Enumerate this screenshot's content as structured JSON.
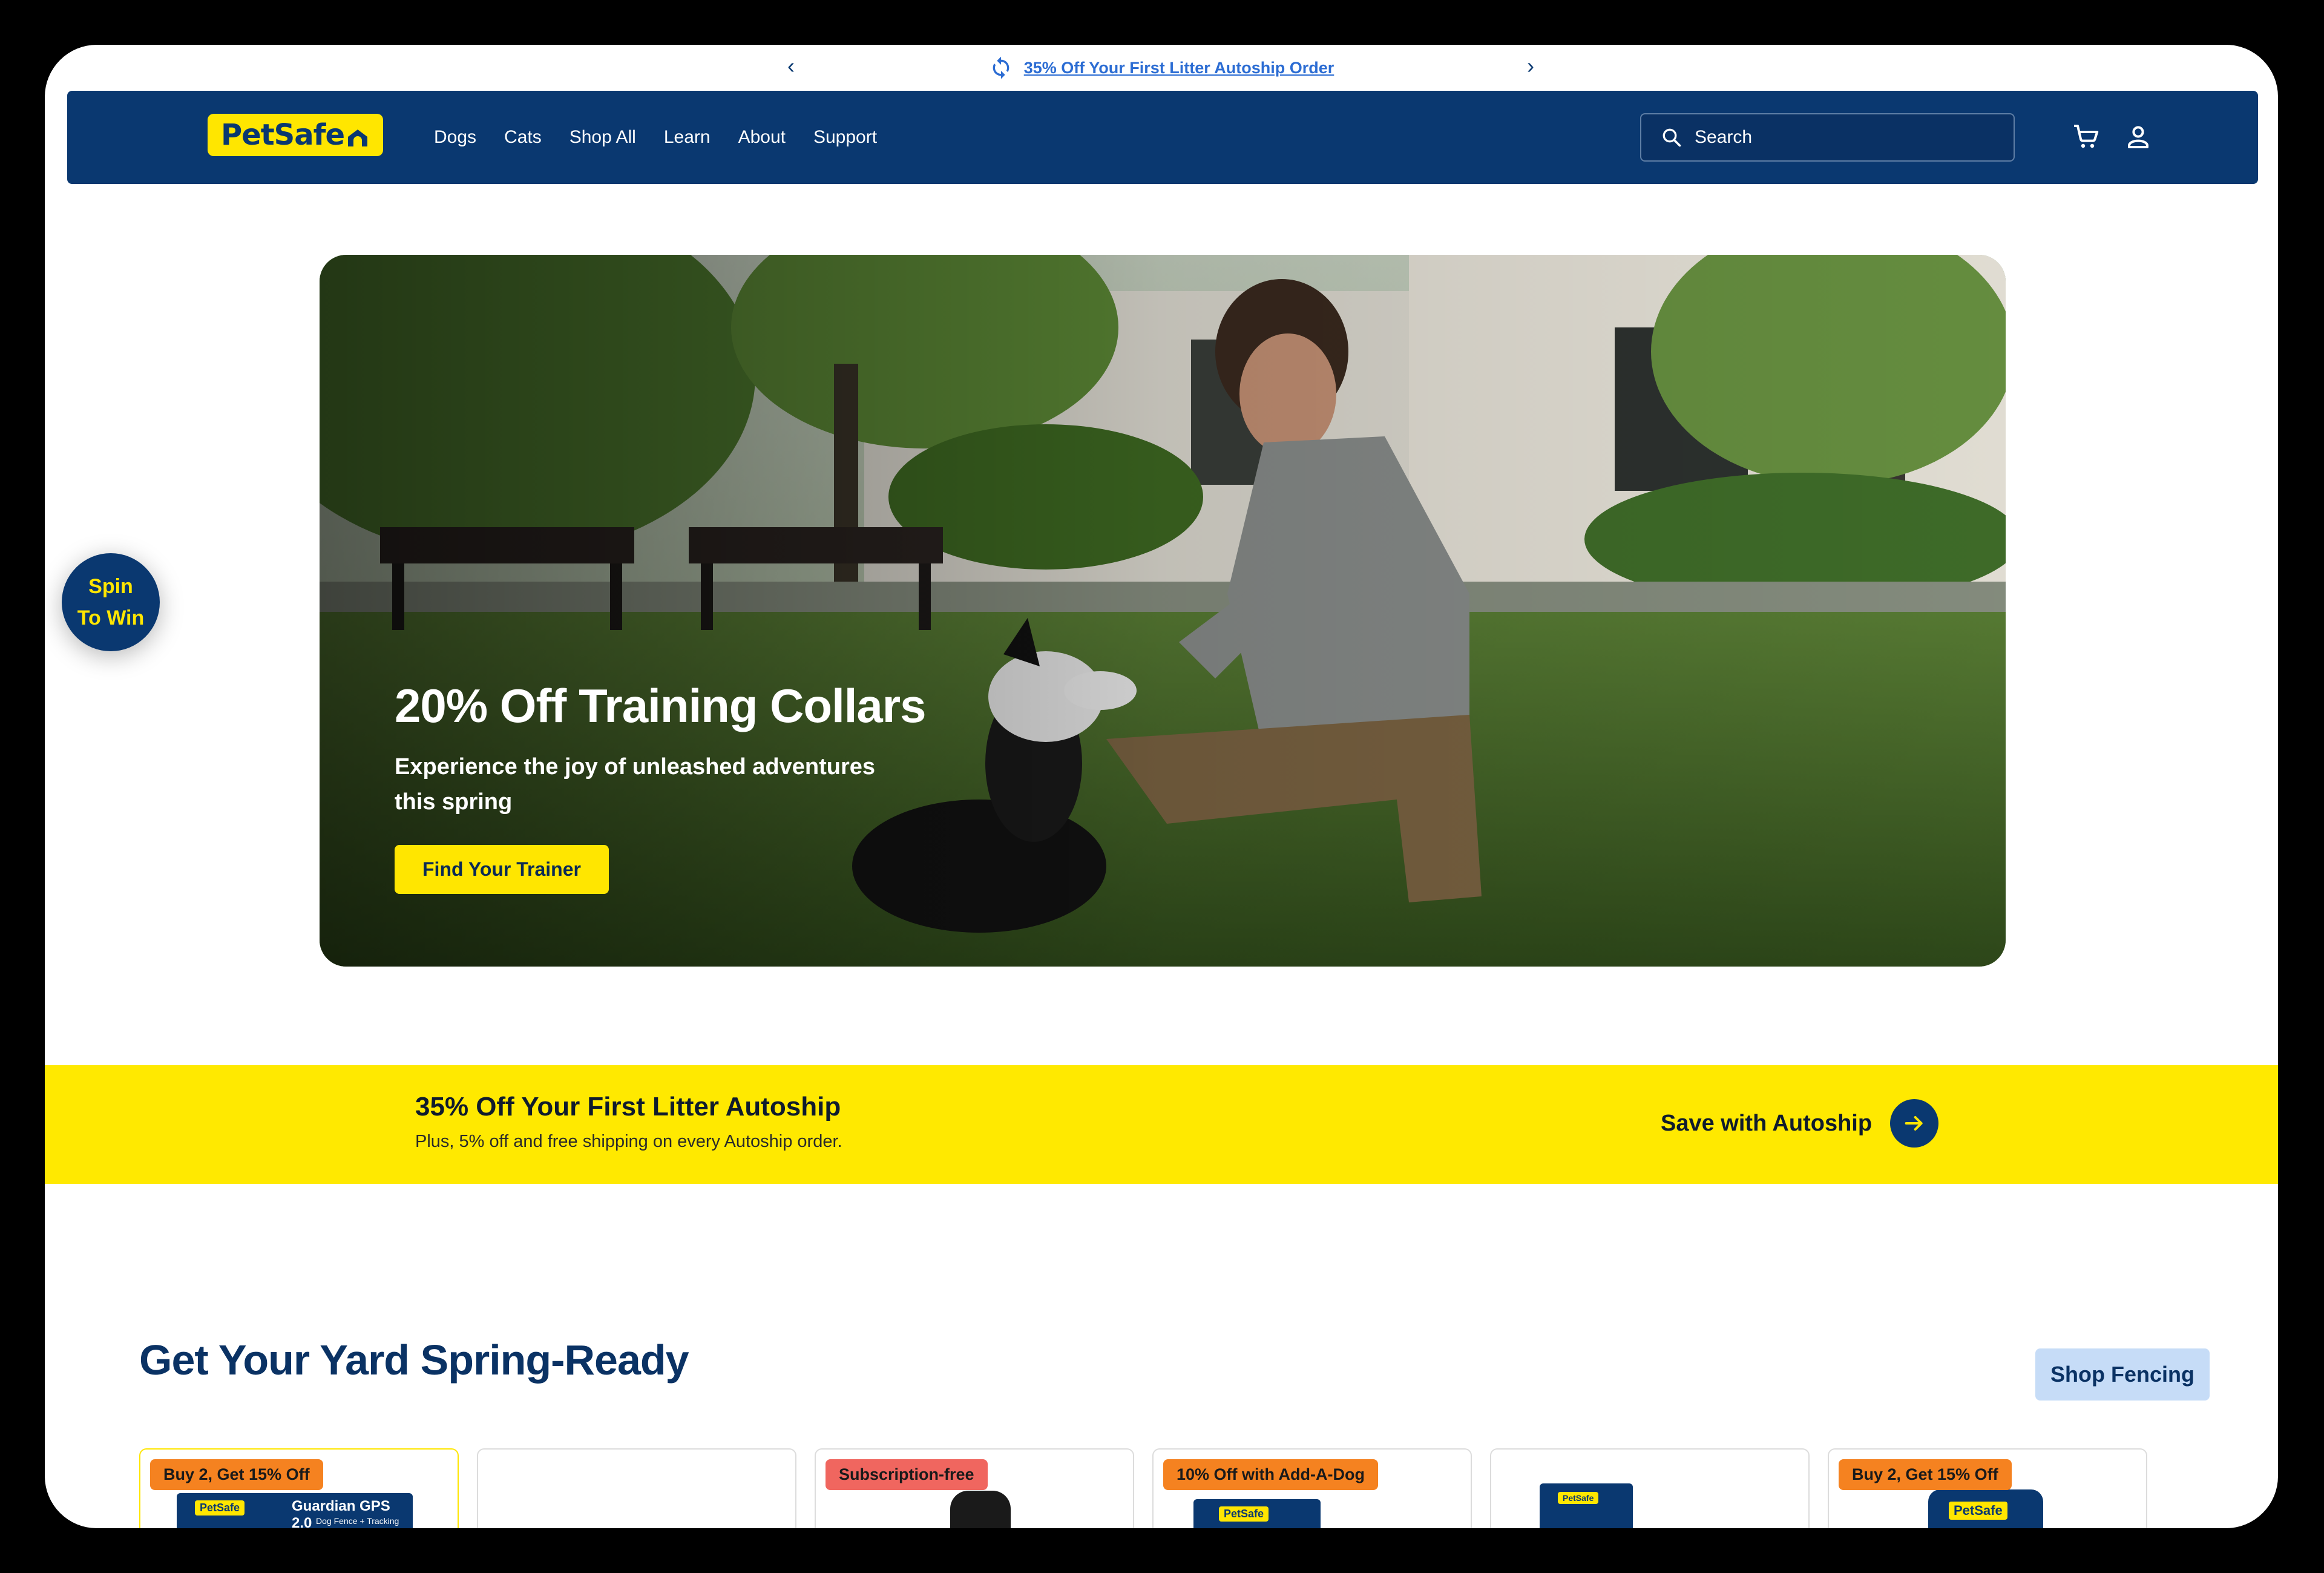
{
  "announcement": {
    "text": "35% Off Your First Litter Autoship Order",
    "prev": "‹",
    "next": "›"
  },
  "header": {
    "logo": "PetSafe",
    "nav": [
      "Dogs",
      "Cats",
      "Shop All",
      "Learn",
      "About",
      "Support"
    ],
    "search_placeholder": "Search"
  },
  "hero": {
    "title": "20% Off Training Collars",
    "subtitle": "Experience the joy of unleashed adventures this spring",
    "cta": "Find Your Trainer"
  },
  "spin": {
    "label": "Spin To Win"
  },
  "autoship": {
    "title": "35% Off Your First Litter Autoship",
    "subtitle": "Plus, 5% off and free shipping on every Autoship order.",
    "link": "Save with Autoship"
  },
  "yard": {
    "title": "Get Your Yard Spring-Ready",
    "button": "Shop Fencing",
    "products": [
      {
        "badge": "Buy 2, Get 15% Off",
        "badge_color": "#f58220",
        "product_text": "Guardian GPS 2.0",
        "product_subtext": "Dog Fence + Tracking"
      },
      {
        "badge": "",
        "badge_color": ""
      },
      {
        "badge": "Subscription-free",
        "badge_color": "#f0665f"
      },
      {
        "badge": "10% Off with Add-A-Dog",
        "badge_color": "#f58220"
      },
      {
        "badge": "",
        "badge_color": ""
      },
      {
        "badge": "Buy 2, Get 15% Off",
        "badge_color": "#f58220"
      }
    ]
  },
  "colors": {
    "navy": "#0a3870",
    "yellow": "#ffe600",
    "link_blue": "#2b6cd3",
    "light_blue_button": "#c6dcf7"
  }
}
